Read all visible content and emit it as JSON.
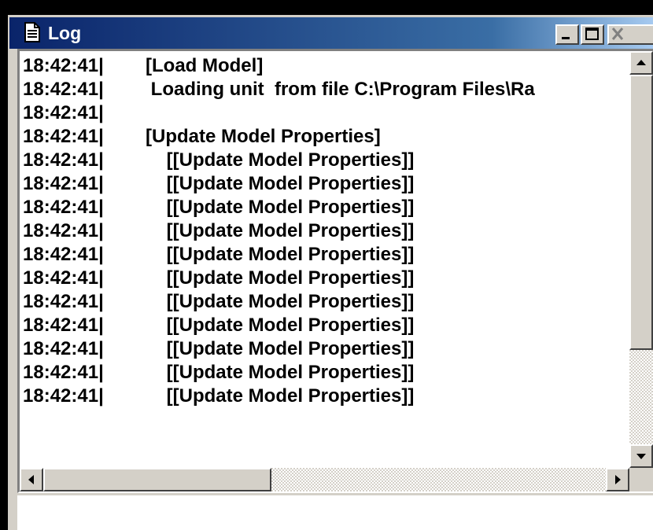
{
  "window": {
    "title": "Log",
    "icons": {
      "title": "document-icon",
      "minimize": "minimize-icon",
      "maximize": "maximize-icon",
      "close": "close-icon"
    }
  },
  "log": {
    "lines": [
      {
        "time": "18:42:41|",
        "message": "[Load Model]"
      },
      {
        "time": "18:42:41|",
        "message": " Loading unit  from file C:\\Program Files\\Ra"
      },
      {
        "time": "18:42:41|",
        "message": ""
      },
      {
        "time": "18:42:41|",
        "message": "[Update Model Properties]"
      },
      {
        "time": "18:42:41|",
        "message": "    [[Update Model Properties]]"
      },
      {
        "time": "18:42:41|",
        "message": "    [[Update Model Properties]]"
      },
      {
        "time": "18:42:41|",
        "message": "    [[Update Model Properties]]"
      },
      {
        "time": "18:42:41|",
        "message": "    [[Update Model Properties]]"
      },
      {
        "time": "18:42:41|",
        "message": "    [[Update Model Properties]]"
      },
      {
        "time": "18:42:41|",
        "message": "    [[Update Model Properties]]"
      },
      {
        "time": "18:42:41|",
        "message": "    [[Update Model Properties]]"
      },
      {
        "time": "18:42:41|",
        "message": "    [[Update Model Properties]]"
      },
      {
        "time": "18:42:41|",
        "message": "    [[Update Model Properties]]"
      },
      {
        "time": "18:42:41|",
        "message": "    [[Update Model Properties]]"
      },
      {
        "time": "18:42:41|",
        "message": "    [[Update Model Properties]]"
      }
    ]
  },
  "scrollbars": {
    "vertical_position": 0.72,
    "horizontal_position": 0.0
  },
  "status": {
    "text": ""
  },
  "colors": {
    "titlebar_start": "#0a246a",
    "titlebar_end": "#a6caf0",
    "face": "#d4d0c8",
    "text": "#000000",
    "background": "#ffffff"
  }
}
